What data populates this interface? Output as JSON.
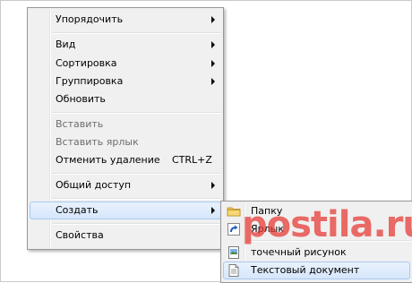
{
  "context_menu": {
    "items": [
      {
        "label": "Упорядочить"
      },
      {
        "label": "Вид"
      },
      {
        "label": "Сортировка"
      },
      {
        "label": "Группировка"
      },
      {
        "label": "Обновить"
      },
      {
        "label": "Вставить"
      },
      {
        "label": "Вставить ярлык"
      },
      {
        "label": "Отменить удаление",
        "shortcut": "CTRL+Z"
      },
      {
        "label": "Общий доступ"
      },
      {
        "label": "Создать"
      },
      {
        "label": "Свойства"
      }
    ]
  },
  "submenu_create": {
    "items": [
      {
        "label": "Папку",
        "icon": "folder-icon"
      },
      {
        "label": "Ярлык",
        "icon": "shortcut-icon"
      },
      {
        "label": "точечный рисунок",
        "icon": "bitmap-icon"
      },
      {
        "label": "Текстовый документ",
        "icon": "text-document-icon"
      }
    ]
  },
  "watermark": "postila.ru",
  "colors": {
    "menu_background": "#f0f0f0",
    "highlight_background": "#dce9fb",
    "highlight_border": "#a8c9f1",
    "disabled_text": "#6d6d6d",
    "watermark": "#e53630"
  }
}
